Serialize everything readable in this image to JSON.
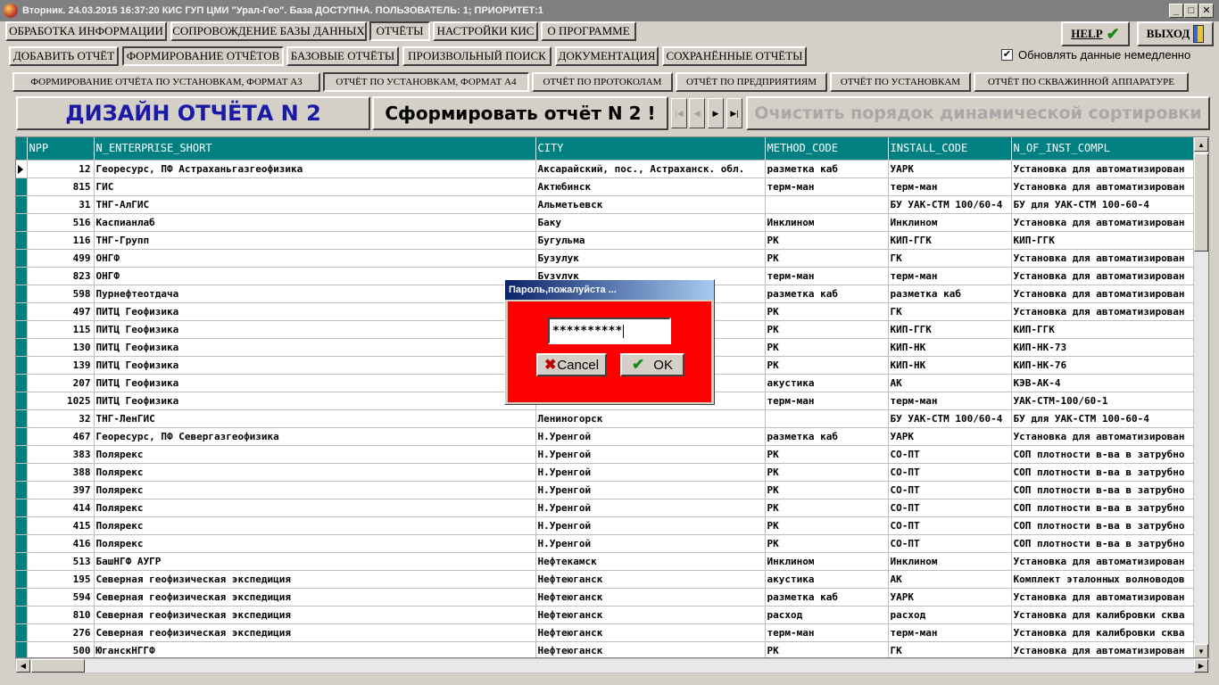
{
  "window": {
    "title": "Вторник. 24.03.2015 16:37:20 КИС ГУП ЦМИ \"Урал-Гео\". База ДОСТУПНА. ПОЛЬЗОВАТЕЛЬ: 1; ПРИОРИТЕТ:1",
    "minimize": "_",
    "maximize": "□",
    "close": "✕"
  },
  "main_menu": [
    "ОБРАБОТКА ИНФОРМАЦИИ",
    "СОПРОВОЖДЕНИЕ БАЗЫ ДАННЫХ",
    "ОТЧЁТЫ",
    "НАСТРОЙКИ КИС",
    "О ПРОГРАММЕ"
  ],
  "help_label": "HELP",
  "exit_label": "ВЫХОД",
  "reports_menu": [
    "ДОБАВИТЬ ОТЧЁТ",
    "ФОРМИРОВАНИЕ ОТЧЁТОВ",
    "БАЗОВЫЕ ОТЧЁТЫ",
    "ПРОИЗВОЛЬНЫЙ ПОИСК",
    "ДОКУМЕНТАЦИЯ",
    "СОХРАНЁННЫЕ ОТЧЁТЫ"
  ],
  "update_checkbox": {
    "label": "Обновлять данные немедленно",
    "checked": true,
    "mark": "✔"
  },
  "sub_tabs": [
    "ФОРМИРОВАНИЕ ОТЧЁТА ПО УСТАНОВКАМ, ФОРМАТ А3",
    "ОТЧЁТ ПО УСТАНОВКАМ, ФОРМАТ А4",
    "ОТЧЁТ ПО ПРОТОКОЛАМ",
    "ОТЧЁТ ПО ПРЕДПРИЯТИЯМ",
    "ОТЧЁТ ПО УСТАНОВКАМ",
    "ОТЧЁТ ПО СКВАЖИННОЙ АППАРАТУРЕ"
  ],
  "design_title": "ДИЗАЙН ОТЧЁТА N 2",
  "design_color": "#1a1aa6",
  "form_button": "Сформировать отчёт N 2 !",
  "nav": {
    "first": "|◀",
    "prev": "◀",
    "next": "▶",
    "last": "▶|"
  },
  "clear_button": "Очистить порядок динамической сортировки",
  "grid": {
    "columns": [
      "NPP",
      "N_ENTERPRISE_SHORT",
      "CITY",
      "METHOD_CODE",
      "INSTALL_CODE",
      "N_OF_INST_COMPL"
    ],
    "header_color": "#008080",
    "rows": [
      [
        "12",
        "Георесурс, ПФ Астраханьгазгеофизика",
        "Аксарайский, пос., Астраханск. обл.",
        "разметка каб",
        "УАРК",
        "Установка для автоматизирован"
      ],
      [
        "815",
        "ГИС",
        "Актюбинск",
        "терм-ман",
        "терм-ман",
        "Установка для автоматизирован"
      ],
      [
        "31",
        "ТНГ-АлГИС",
        "Альметьевск",
        "",
        "БУ УАК-СТМ 100/60-4",
        "БУ для УАК-СТМ 100-60-4"
      ],
      [
        "516",
        "Каспианлаб",
        "Баку",
        "Инклином",
        "Инклином",
        "Установка для автоматизирован"
      ],
      [
        "116",
        "ТНГ-Групп",
        "Бугульма",
        "РК",
        "КИП-ГГК",
        "КИП-ГГК"
      ],
      [
        "499",
        "ОНГФ",
        "Бузулук",
        "РК",
        "ГК",
        "Установка для автоматизирован"
      ],
      [
        "823",
        "ОНГФ",
        "Бузулук",
        "терм-ман",
        "терм-ман",
        "Установка для автоматизирован"
      ],
      [
        "598",
        "Пурнефтеотдача",
        "",
        "разметка каб",
        "разметка каб",
        "Установка для автоматизирован"
      ],
      [
        "497",
        "ПИТЦ Геофизика",
        "",
        "РК",
        "ГК",
        "Установка для автоматизирован"
      ],
      [
        "115",
        "ПИТЦ Геофизика",
        "",
        "РК",
        "КИП-ГГК",
        "КИП-ГГК"
      ],
      [
        "130",
        "ПИТЦ Геофизика",
        "",
        "РК",
        "КИП-НК",
        "КИП-НК-73"
      ],
      [
        "139",
        "ПИТЦ Геофизика",
        "",
        "РК",
        "КИП-НК",
        "КИП-НК-76"
      ],
      [
        "207",
        "ПИТЦ Геофизика",
        "",
        "акустика",
        "АК",
        "КЭВ-АК-4"
      ],
      [
        "1025",
        "ПИТЦ Геофизика",
        "",
        "терм-ман",
        "терм-ман",
        "УАК-СТМ-100/60-1"
      ],
      [
        "32",
        "ТНГ-ЛенГИС",
        "Лениногорск",
        "",
        "БУ УАК-СТМ 100/60-4",
        "БУ для УАК-СТМ 100-60-4"
      ],
      [
        "467",
        "Георесурс, ПФ Севергазгеофизика",
        "Н.Уренгой",
        "разметка каб",
        "УАРК",
        "Установка для автоматизирован"
      ],
      [
        "383",
        "Полярекс",
        "Н.Уренгой",
        "РК",
        "СО-ПТ",
        "СОП плотности в-ва в затрубно"
      ],
      [
        "388",
        "Полярекс",
        "Н.Уренгой",
        "РК",
        "СО-ПТ",
        "СОП плотности в-ва в затрубно"
      ],
      [
        "397",
        "Полярекс",
        "Н.Уренгой",
        "РК",
        "СО-ПТ",
        "СОП плотности в-ва в затрубно"
      ],
      [
        "414",
        "Полярекс",
        "Н.Уренгой",
        "РК",
        "СО-ПТ",
        "СОП плотности в-ва в затрубно"
      ],
      [
        "415",
        "Полярекс",
        "Н.Уренгой",
        "РК",
        "СО-ПТ",
        "СОП плотности в-ва в затрубно"
      ],
      [
        "416",
        "Полярекс",
        "Н.Уренгой",
        "РК",
        "СО-ПТ",
        "СОП плотности в-ва в затрубно"
      ],
      [
        "513",
        "БашНГФ АУГР",
        "Нефтекамск",
        "Инклином",
        "Инклином",
        "Установка для автоматизирован"
      ],
      [
        "195",
        "Северная геофизическая экспедиция",
        "Нефтеюганск",
        "акустика",
        "АК",
        "Комплект эталонных волноводов"
      ],
      [
        "594",
        "Северная геофизическая экспедиция",
        "Нефтеюганск",
        "разметка каб",
        "УАРК",
        "Установка для автоматизирован"
      ],
      [
        "810",
        "Северная геофизическая экспедиция",
        "Нефтеюганск",
        "расход",
        "расход",
        "Установка для калибровки сква"
      ],
      [
        "276",
        "Северная геофизическая экспедиция",
        "Нефтеюганск",
        "терм-ман",
        "терм-ман",
        "Установка для калибровки сква"
      ],
      [
        "500",
        "ЮганскНГГФ",
        "Нефтеюганск",
        "РК",
        "ГК",
        "Установка для автоматизирован"
      ]
    ]
  },
  "dialog": {
    "title": "Пароль,пожалуйста ...",
    "password_mask": "**********",
    "cancel": "Cancel",
    "ok": "OK",
    "body_color": "#ff0000"
  }
}
